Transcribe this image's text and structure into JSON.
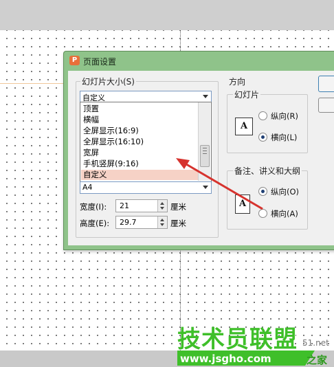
{
  "dialog": {
    "title": "页面设置"
  },
  "slide_size": {
    "label": "幻灯片大小(S)",
    "selected": "自定义",
    "options": [
      "顶置",
      "横幅",
      "全屏显示(16:9)",
      "全屏显示(16:10)",
      "宽屏",
      "手机竖屏(9:16)",
      "自定义"
    ],
    "paper_value": "A4",
    "width_label": "宽度(I):",
    "width_value": "21",
    "width_unit": "厘米",
    "height_label": "高度(E):",
    "height_value": "29.7",
    "height_unit": "厘米"
  },
  "orientation": {
    "label": "方向",
    "slides": {
      "label": "幻灯片",
      "portrait_label": "纵向(R)",
      "landscape_label": "横向(L)",
      "selected": "landscape",
      "icon_letter": "A"
    },
    "notes": {
      "label": "备注、讲义和大纲",
      "portrait_label": "纵向(O)",
      "landscape_label": "横向(A)",
      "selected": "portrait",
      "icon_letter": "A"
    }
  },
  "watermark": {
    "brand": "技术员联盟",
    "url": "www.jsgho.com",
    "suffix": "之家",
    "domain_fragment": "51.net"
  },
  "colors": {
    "accent_green": "#3fbf2a",
    "arrow_red": "#d6332e",
    "dialog_frame": "#8fc38a",
    "selection": "#f6d2c6"
  }
}
